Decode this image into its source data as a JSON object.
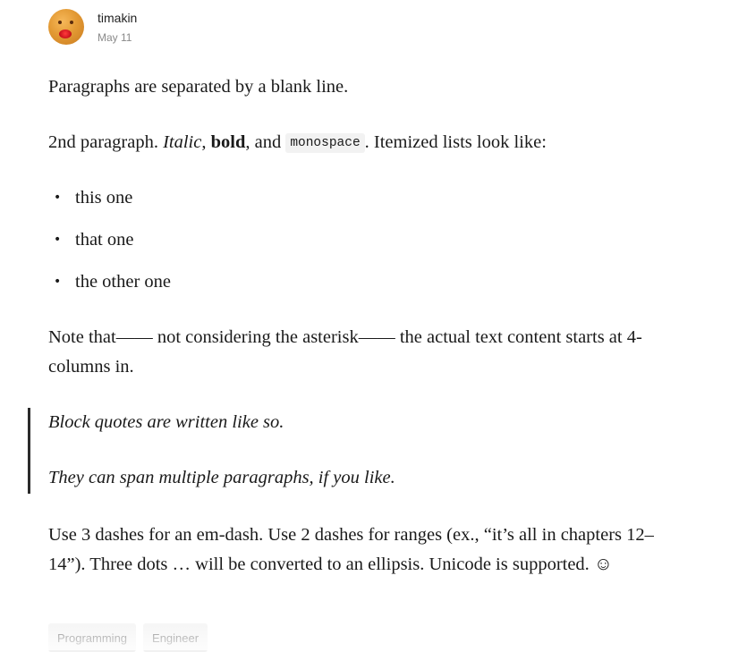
{
  "post": {
    "author": "timakin",
    "date": "May 11",
    "avatar_icon": "avatar-icon"
  },
  "content": {
    "p1": "Paragraphs are separated by a blank line.",
    "p2": {
      "a": "2nd paragraph. ",
      "italic": "Italic",
      "b": ", ",
      "bold": "bold",
      "c": ", and ",
      "code": "monospace",
      "d": ". Itemized lists look like:"
    },
    "list": [
      "this one",
      "that one",
      "the other one"
    ],
    "bullet": "•",
    "p3": "Note that—— not considering the asterisk—— the actual text content starts at 4-columns in.",
    "quote1": "Block quotes are written like so.",
    "quote2": "They can span multiple paragraphs, if you like.",
    "p4": "Use 3 dashes for an em-dash. Use 2 dashes for ranges (ex., “it’s all in chapters 12–14”). Three dots … will be converted to an ellipsis. Unicode is supported. ☺"
  },
  "tags": [
    "Programming",
    "Engineer"
  ],
  "colors": {
    "quote_bar": "#2b2b2b",
    "tag_bg": "#f1f1f1",
    "date": "#8a8a8a"
  }
}
